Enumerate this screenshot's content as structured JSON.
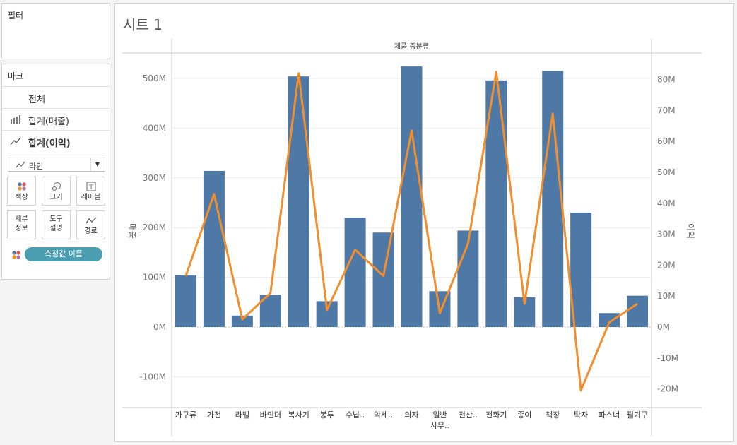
{
  "filters": {
    "title": "필터"
  },
  "marks": {
    "title": "마크",
    "rows": [
      {
        "label": "전체",
        "icon": "none"
      },
      {
        "label": "합계(매출)",
        "icon": "bar-chart-icon"
      },
      {
        "label": "합계(이익)",
        "icon": "line-chart-icon"
      }
    ],
    "mark_type": "라인",
    "cards": [
      {
        "label": "색상",
        "icon": "color-dots-icon"
      },
      {
        "label": "크기",
        "icon": "size-icon"
      },
      {
        "label": "레이블",
        "icon": "label-icon"
      },
      {
        "label": "세부\n정보",
        "icon": "detail-icon"
      },
      {
        "label": "도구\n설명",
        "icon": "tooltip-icon"
      },
      {
        "label": "경로",
        "icon": "path-icon"
      }
    ],
    "pill": "측정값 이름"
  },
  "sheet": {
    "title": "시트 1",
    "header": "제품 중분류",
    "left_axis_label": "매출",
    "right_axis_label": "이익"
  },
  "colors": {
    "bar": "#4e79a7",
    "line": "#f28e2b"
  },
  "chart_data": {
    "type": "bar+line",
    "categories": [
      "가구류",
      "가전",
      "라벨",
      "바인더",
      "복사기",
      "봉투",
      "수납..",
      "악세..",
      "의자",
      "일반\n사무..",
      "전산..",
      "전화기",
      "종이",
      "책장",
      "탁자",
      "파스너",
      "필기구"
    ],
    "series": [
      {
        "name": "합계(매출)",
        "axis": "left",
        "type": "bar",
        "values": [
          104,
          314,
          23,
          65,
          504,
          52,
          220,
          190,
          524,
          72,
          194,
          496,
          60,
          515,
          230,
          28,
          63
        ]
      },
      {
        "name": "합계(이익)",
        "axis": "right",
        "type": "line",
        "values": [
          16.5,
          43,
          2.5,
          11,
          82,
          5.5,
          25,
          16.5,
          63.5,
          4.5,
          27,
          82.5,
          7.5,
          69,
          -20.5,
          1.5,
          7.5
        ]
      }
    ],
    "left_axis": {
      "ticks": [
        "-100M",
        "0M",
        "100M",
        "200M",
        "300M",
        "400M",
        "500M"
      ],
      "unit": "M"
    },
    "right_axis": {
      "ticks": [
        "-20M",
        "-10M",
        "0M",
        "10M",
        "20M",
        "30M",
        "40M",
        "50M",
        "60M",
        "70M",
        "80M"
      ],
      "unit": "M"
    },
    "grid": true
  }
}
